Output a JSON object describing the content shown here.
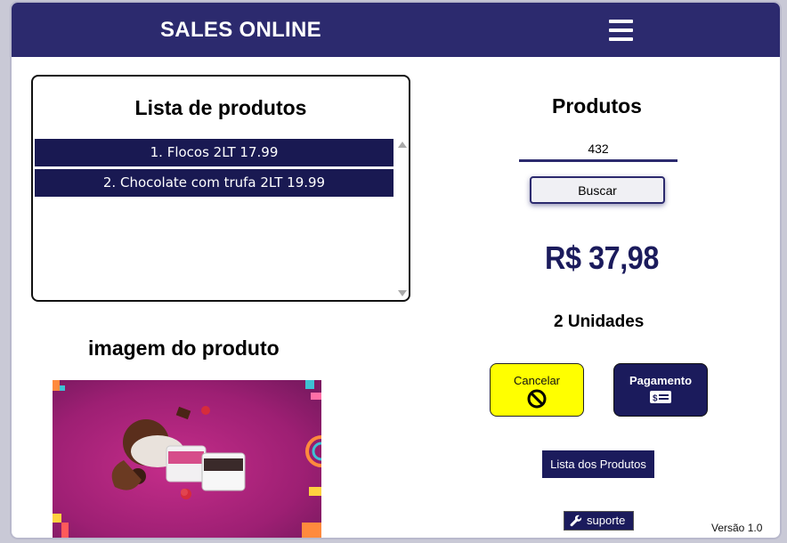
{
  "header": {
    "title": "SALES ONLINE",
    "menu_icon": "hamburger-menu-icon",
    "background": "#2c2a6e"
  },
  "product_list": {
    "title": "Lista de produtos",
    "items": [
      "1. Flocos 2LT 17.99",
      "2. Chocolate com trufa 2LT 19.99"
    ]
  },
  "product_image": {
    "title": "imagem do produto"
  },
  "products": {
    "title": "Produtos",
    "code_value": "432",
    "search_label": "Buscar",
    "total": "R$ 37,98",
    "units": "2 Unidades"
  },
  "actions": {
    "cancel_label": "Cancelar",
    "cancel_icon": "prohibited-icon",
    "payment_label": "Pagamento",
    "payment_icon": "money-bill-icon",
    "list_label": "Lista dos Produtos",
    "support_label": "suporte",
    "support_icon": "wrench-icon"
  },
  "footer": {
    "version": "Versão 1.0"
  },
  "colors": {
    "accent": "#1b1b5c",
    "cancel": "#ffff00"
  }
}
